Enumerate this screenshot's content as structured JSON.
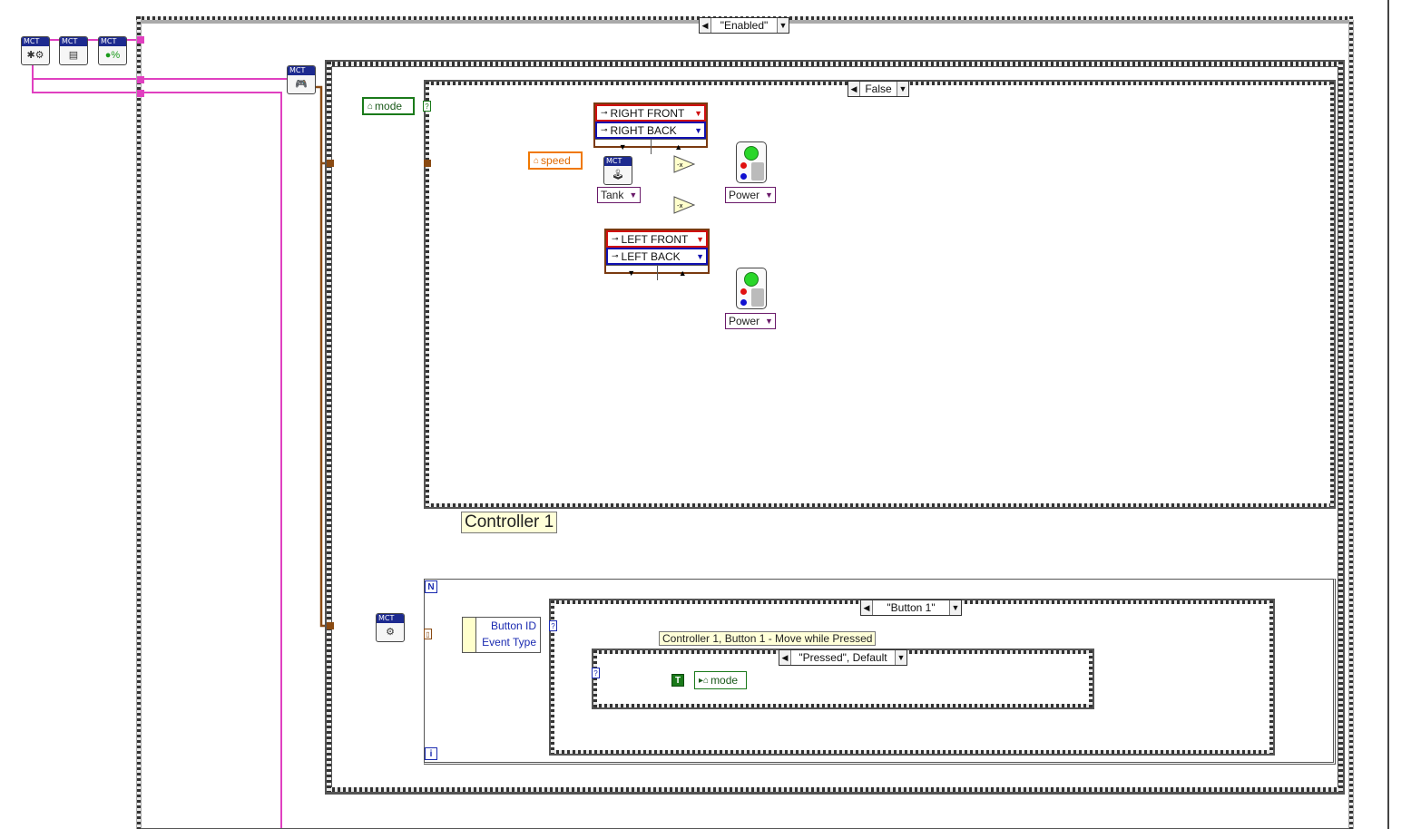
{
  "outer_case": {
    "selector": "\"Enabled\""
  },
  "inner_case": {
    "selector": "False"
  },
  "event_case": {
    "selector": "\"Button 1\""
  },
  "pressed_case": {
    "selector": "\"Pressed\", Default"
  },
  "controller_label": "Controller 1",
  "button_label": "Controller 1, Button 1 - Move while Pressed",
  "locals": {
    "mode_read": "mode",
    "speed": "speed",
    "mode_write": "mode"
  },
  "drive_mode": "Tank",
  "right_motors": {
    "front": "RIGHT FRONT",
    "back": "RIGHT BACK"
  },
  "left_motors": {
    "front": "LEFT FRONT",
    "back": "LEFT BACK"
  },
  "power_labels": [
    "Power",
    "Power"
  ],
  "unbundle": {
    "button_id": "Button ID",
    "event_type": "Event Type"
  },
  "loop_terminals": {
    "count": "N",
    "iteration": "i"
  },
  "bool_const": "T",
  "vi_header": "MCT",
  "icons": [
    "mct-bluetooth-icon",
    "mct-printer-icon",
    "mct-percent-icon",
    "mct-controller-icon",
    "mct-joystick-icon",
    "mct-event-icon",
    "tunnel-icon",
    "negate-icon"
  ]
}
